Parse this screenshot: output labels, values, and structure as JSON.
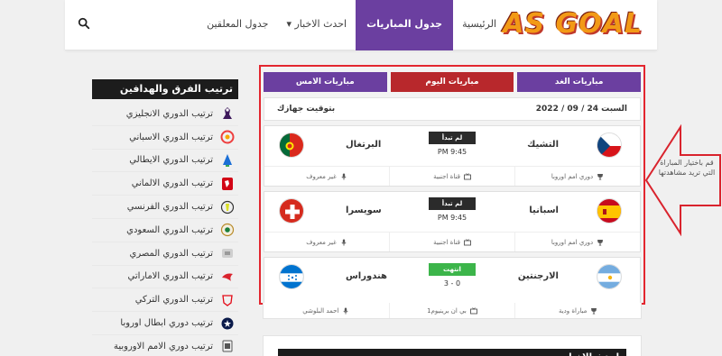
{
  "header": {
    "logo": "AS GOAL",
    "nav": [
      "الرئيسية",
      "جدول المباريات",
      "احدث الاخبار ▾",
      "جدول المعلقين"
    ]
  },
  "sidebar": {
    "title": "ترتيب الفرق والهدافين",
    "items": [
      {
        "label": "ترتيب الدوري الانجليزي",
        "icon": "premier-league-icon",
        "color": "#3d195b"
      },
      {
        "label": "ترتيب الدوري الاسباني",
        "icon": "laliga-icon",
        "color": "#ee3e3e"
      },
      {
        "label": "ترتيب الدوري الايطالي",
        "icon": "serie-a-icon",
        "color": "#1b6fd6"
      },
      {
        "label": "ترتيب الدوري الالماني",
        "icon": "bundesliga-icon",
        "color": "#d20515"
      },
      {
        "label": "ترتيب الدوري الفرنسي",
        "icon": "ligue1-icon",
        "color": "#333333"
      },
      {
        "label": "ترتيب الدوري السعودي",
        "icon": "saudi-league-icon",
        "color": "#b88b2a"
      },
      {
        "label": "ترتيب الدوري المصري",
        "icon": "egypt-league-icon",
        "color": "#9a9a9a"
      },
      {
        "label": "ترتيب الدوري الاماراتي",
        "icon": "uae-league-icon",
        "color": "#d9232d"
      },
      {
        "label": "ترتيب الدوري التركي",
        "icon": "turkey-league-icon",
        "color": "#e30a17"
      },
      {
        "label": "ترتيب دوري ابطال اوروبا",
        "icon": "champions-league-icon",
        "color": "#0a1a4a"
      },
      {
        "label": "ترتيب دوري الامم الاوروبية",
        "icon": "nations-league-icon",
        "color": "#555555"
      }
    ]
  },
  "tabs": {
    "future": "مباريات الغد",
    "today": "مباريات اليوم",
    "past": "مباريات الامس"
  },
  "date_row": {
    "date": "السبت 24 / 09 / 2022",
    "tz": "بتوقيت جهازك"
  },
  "matches": [
    {
      "home": "التشيك",
      "away": "البرتغال",
      "status": "لم تبدأ",
      "time": "PM 9:45",
      "competition": "دوري امم اوروبا",
      "channel": "قناة اجنبية",
      "commentator": "غير معروف",
      "home_flag": "czech-flag",
      "away_flag": "portugal-flag",
      "status_kind": "live"
    },
    {
      "home": "اسبانيا",
      "away": "سويسرا",
      "status": "لم تبدأ",
      "time": "PM 9:45",
      "competition": "دوري امم اوروبا",
      "channel": "قناة اجنبية",
      "commentator": "غير معروف",
      "home_flag": "spain-flag",
      "away_flag": "switzerland-flag",
      "status_kind": "live"
    },
    {
      "home": "الارجنتين",
      "away": "هندوراس",
      "status": "انتهت",
      "time": "3 - 0",
      "competition": "مباراة ودية",
      "channel": "بي ان برينيوم1",
      "commentator": "احمد البلوشي",
      "home_flag": "argentina-flag",
      "away_flag": "honduras-flag",
      "status_kind": "done"
    }
  ],
  "annotation": {
    "text": "قم باختيار المباراة التي تريد مشاهدتها",
    "color": "#d9232d"
  },
  "bottom": {
    "title": "احدث الاخبار"
  }
}
